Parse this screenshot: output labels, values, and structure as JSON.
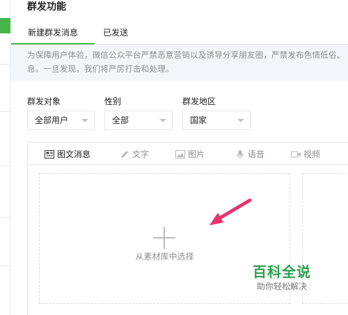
{
  "page": {
    "title": "群发功能"
  },
  "tabs": [
    {
      "label": "新建群发消息",
      "active": true
    },
    {
      "label": "已发送",
      "active": false
    }
  ],
  "notice": {
    "line1": "为保障用户体验，微信公众平台严禁恶意营销以及诱导分享朋友圈，严禁发布色情低俗、",
    "line2": "息。一旦发现，我们将严厉打击和处理。"
  },
  "filters": {
    "target": {
      "label": "群发对象",
      "value": "全部用户"
    },
    "gender": {
      "label": "性别",
      "value": "全部"
    },
    "region": {
      "label": "群发地区",
      "value": "国家"
    }
  },
  "editor_tabs": [
    {
      "label": "图文消息",
      "icon": "news-icon",
      "active": true
    },
    {
      "label": "文字",
      "icon": "pencil-icon",
      "active": false
    },
    {
      "label": "图片",
      "icon": "image-icon",
      "active": false
    },
    {
      "label": "语音",
      "icon": "microphone-icon",
      "active": false
    },
    {
      "label": "视频",
      "icon": "video-icon",
      "active": false
    }
  ],
  "picker": {
    "label": "从素材库中选择"
  },
  "watermark": {
    "title": "百科全说",
    "subtitle": "助你轻松解决"
  },
  "colors": {
    "accent": "#44b549",
    "arrow": "#e8336d",
    "watermark": "#2ba04a"
  }
}
